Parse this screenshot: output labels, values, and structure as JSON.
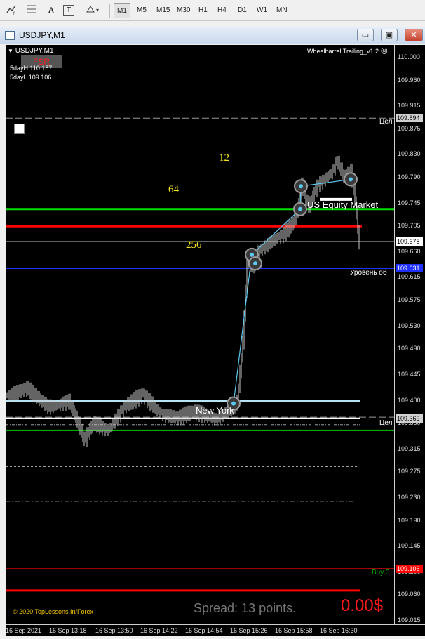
{
  "toolbar": {
    "timeframes": [
      "M1",
      "M5",
      "M15",
      "M30",
      "H1",
      "H4",
      "D1",
      "W1",
      "MN"
    ],
    "active_timeframe": "M1",
    "text_tool_label": "A",
    "label_tool_label": "T"
  },
  "window": {
    "title": "USDJPY,M1",
    "minimize": "▭",
    "restore": "▣",
    "close": "✕"
  },
  "chart": {
    "symbol_label": "USDJPY,M1",
    "indicator_name": "Wheelbarrel Trailing_v1.2",
    "fsr_label": "FSR",
    "five_day_high": "5dayH 110.157",
    "five_day_low": "5dayL 109.106",
    "fib_labels": {
      "l12": "12",
      "l64": "64",
      "l256": "256"
    },
    "session_labels": {
      "us_equity": "US Equity Market",
      "new_york": "New York"
    },
    "right_labels": {
      "cel_top": "Цел",
      "level_ob": "Уровень об",
      "cel_bottom": "Цел",
      "buy": "Buy 3"
    },
    "copyright": "© 2020 TopLessons.In/Forex",
    "spread": "Spread: 13 points.",
    "profit": "0.00$",
    "colors": {
      "bid_line": "#ffffff",
      "green_level": "#00e000",
      "red_level": "#ff0000",
      "blue_level": "#1e2fff",
      "trendline": "#5bc8f0",
      "fib_text": "#f5e51e"
    }
  },
  "chart_data": {
    "type": "candlestick",
    "symbol": "USDJPY",
    "timeframe": "M1",
    "y_ticks": [
      "110.000",
      "109.960",
      "109.915",
      "109.875",
      "109.830",
      "109.790",
      "109.745",
      "109.705",
      "109.660",
      "109.615",
      "109.575",
      "109.530",
      "109.490",
      "109.445",
      "109.400",
      "109.360",
      "109.315",
      "109.275",
      "109.230",
      "109.190",
      "109.145",
      "109.100",
      "109.060",
      "109.015"
    ],
    "x_ticks": [
      "16 Sep 2021",
      "16 Sep 13:18",
      "16 Sep 13:50",
      "16 Sep 14:22",
      "16 Sep 14:54",
      "16 Sep 15:26",
      "16 Sep 15:58",
      "16 Sep 16:30"
    ],
    "price_boxes": [
      {
        "label": "109.894",
        "color": "#d0d0d0",
        "text": "#000000",
        "price": 109.894
      },
      {
        "label": "109.678",
        "color": "#ffffff",
        "text": "#000000",
        "price": 109.678
      },
      {
        "label": "109.631",
        "color": "#1e2fff",
        "text": "#ffffff",
        "price": 109.631
      },
      {
        "label": "109.369",
        "color": "#d0d0d0",
        "text": "#000000",
        "price": 109.369
      },
      {
        "label": "109.106",
        "color": "#ff0000",
        "text": "#ffffff",
        "price": 109.106
      }
    ],
    "close_price": 109.678,
    "ylim": [
      109.015,
      110.0
    ]
  }
}
